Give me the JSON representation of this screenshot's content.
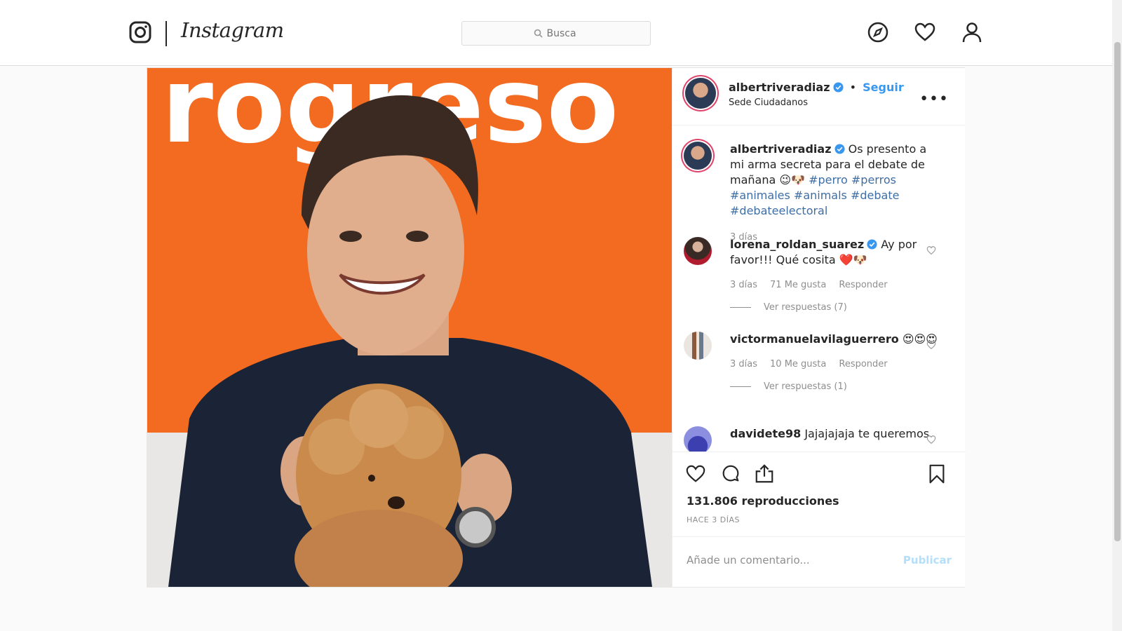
{
  "nav": {
    "brand": "Instagram",
    "search_placeholder": "Busca"
  },
  "post": {
    "username": "albertriveradiaz",
    "follow_label": "Seguir",
    "location": "Sede Ciudadanos",
    "more_label": "•••",
    "image_text": "rogreso",
    "caption": {
      "username": "albertriveradiaz",
      "text": "Os presento a mi arma secreta para el debate de mañana",
      "emoji": "😉🐶",
      "hashtags": [
        "#perro",
        "#perros",
        "#animales",
        "#animals",
        "#debate",
        "#debateelectoral"
      ],
      "time": "3 días"
    },
    "comments": [
      {
        "username": "lorena_roldan_suarez",
        "text": "Ay por favor!!! Qué cosita ❤️🐶",
        "time": "3 días",
        "likes": "71 Me gusta",
        "reply": "Responder",
        "replies": "Ver respuestas (7)"
      },
      {
        "username": "victormanuelavilaguerrero",
        "text": "😍😍😍",
        "time": "3 días",
        "likes": "10 Me gusta",
        "reply": "Responder",
        "replies": "Ver respuestas (1)"
      },
      {
        "username": "davidete98",
        "text": "Jajajajaja te queremos"
      }
    ],
    "views": "131.806 reproducciones",
    "ago": "HACE 3 DÍAS",
    "comment_placeholder": "Añade un comentario...",
    "publish_label": "Publicar"
  },
  "colors": {
    "accent": "#3897f0",
    "image_background": "#f26b21",
    "publish_disabled": "#b2dffc"
  },
  "icons": [
    "instagram-icon",
    "search-icon",
    "compass-icon",
    "heart-icon",
    "profile-icon",
    "verified-icon",
    "more-icon",
    "like-icon",
    "comment-icon",
    "share-icon",
    "bookmark-icon"
  ]
}
